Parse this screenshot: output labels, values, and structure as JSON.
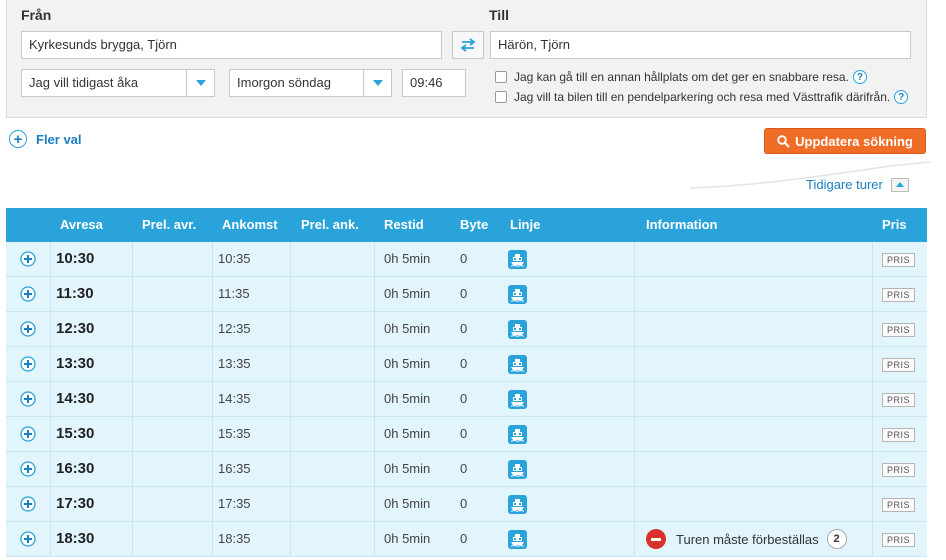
{
  "search": {
    "from_label": "Från",
    "to_label": "Till",
    "from_value": "Kyrkesunds brygga, Tjörn",
    "to_value": "Härön, Tjörn",
    "time_mode": "Jag vill tidigast åka",
    "day": "Imorgon söndag",
    "time": "09:46",
    "option_faster_stop": "Jag kan gå till en annan hållplats om det ger en snabbare resa.",
    "option_park_ride": "Jag vill ta bilen till en pendelparkering och resa med Västtrafik därifrån.",
    "help_symbol": "?"
  },
  "actions": {
    "more_options": "Fler val",
    "update_search": "Uppdatera sökning",
    "earlier_trips": "Tidigare turer"
  },
  "icons": {
    "plus": "+",
    "swap": "swap-arrows-icon",
    "ferry": "ferry-icon",
    "search": "magnifier-icon",
    "no_entry": "no-entry-icon"
  },
  "colors": {
    "accent": "#29a3d9",
    "row_bg": "#e2f4fc",
    "update_button": "#f06d28",
    "warning": "#d9322b"
  },
  "table": {
    "headers": {
      "departure": "Avresa",
      "prel_departure": "Prel. avr.",
      "arrival": "Ankomst",
      "prel_arrival": "Prel. ank.",
      "duration": "Restid",
      "changes": "Byte",
      "line": "Linje",
      "information": "Information",
      "price": "Pris"
    },
    "price_button": "PRIS",
    "rows": [
      {
        "departure": "10:30",
        "prel_departure": "",
        "arrival": "10:35",
        "prel_arrival": "",
        "duration": "0h 5min",
        "changes": "0",
        "info": "",
        "info_count": ""
      },
      {
        "departure": "11:30",
        "prel_departure": "",
        "arrival": "11:35",
        "prel_arrival": "",
        "duration": "0h 5min",
        "changes": "0",
        "info": "",
        "info_count": ""
      },
      {
        "departure": "12:30",
        "prel_departure": "",
        "arrival": "12:35",
        "prel_arrival": "",
        "duration": "0h 5min",
        "changes": "0",
        "info": "",
        "info_count": ""
      },
      {
        "departure": "13:30",
        "prel_departure": "",
        "arrival": "13:35",
        "prel_arrival": "",
        "duration": "0h 5min",
        "changes": "0",
        "info": "",
        "info_count": ""
      },
      {
        "departure": "14:30",
        "prel_departure": "",
        "arrival": "14:35",
        "prel_arrival": "",
        "duration": "0h 5min",
        "changes": "0",
        "info": "",
        "info_count": ""
      },
      {
        "departure": "15:30",
        "prel_departure": "",
        "arrival": "15:35",
        "prel_arrival": "",
        "duration": "0h 5min",
        "changes": "0",
        "info": "",
        "info_count": ""
      },
      {
        "departure": "16:30",
        "prel_departure": "",
        "arrival": "16:35",
        "prel_arrival": "",
        "duration": "0h 5min",
        "changes": "0",
        "info": "",
        "info_count": ""
      },
      {
        "departure": "17:30",
        "prel_departure": "",
        "arrival": "17:35",
        "prel_arrival": "",
        "duration": "0h 5min",
        "changes": "0",
        "info": "",
        "info_count": ""
      },
      {
        "departure": "18:30",
        "prel_departure": "",
        "arrival": "18:35",
        "prel_arrival": "",
        "duration": "0h 5min",
        "changes": "0",
        "info": "Turen måste förbeställas",
        "info_count": "2"
      }
    ]
  }
}
